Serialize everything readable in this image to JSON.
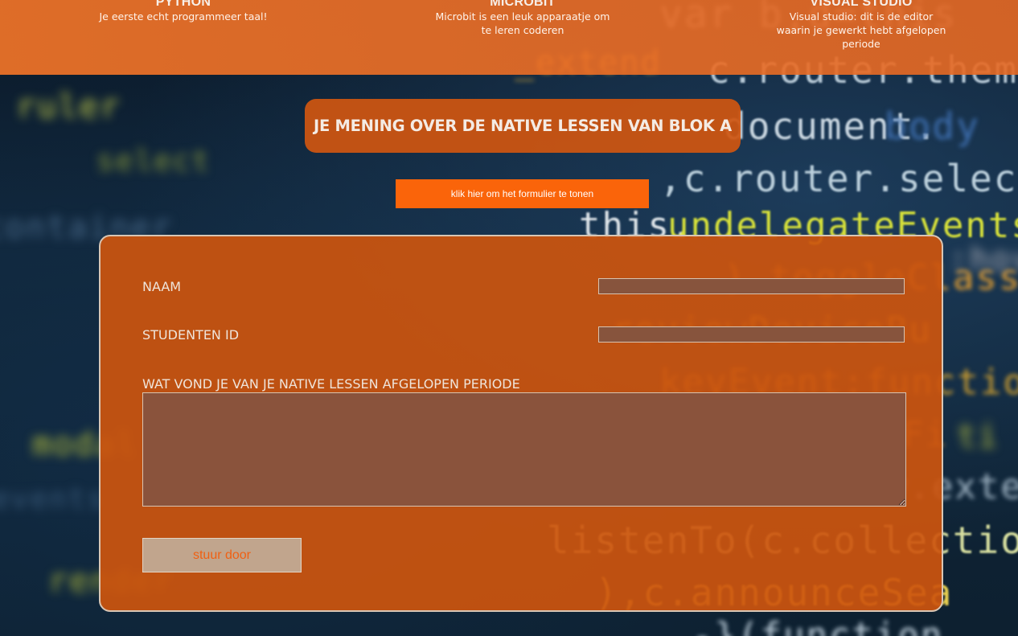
{
  "nav": {
    "items": [
      {
        "title": "PYTHON",
        "desc": "Je eerste echt programmeer taal!"
      },
      {
        "title": "MICROBIT",
        "desc": "Microbit is een leuk apparaatje om te leren coderen"
      },
      {
        "title": "VISUAL STUDIO",
        "desc": "Visual studio: dit is de editor waarin je gewerkt hebt afgelopen periode"
      }
    ]
  },
  "heading": "JE MENING OVER DE NATIVE LESSEN VAN BLOK A",
  "toggle_label": "klik hier om het formulier te tonen",
  "form": {
    "name_label": "NAAM",
    "name_value": "",
    "id_label": "STUDENTEN ID",
    "id_value": "",
    "question_label": "WAT VOND JE VAN JE NATIVE LESSEN AFGELOPEN PERIODE",
    "question_value": "",
    "submit_label": "stuur door"
  },
  "colors": {
    "accent": "#fa640a",
    "nav_bg": "#ee7328",
    "form_bg": "#cd550e",
    "field_bg": "#87543d",
    "submit_bg": "#c1a58d"
  }
}
